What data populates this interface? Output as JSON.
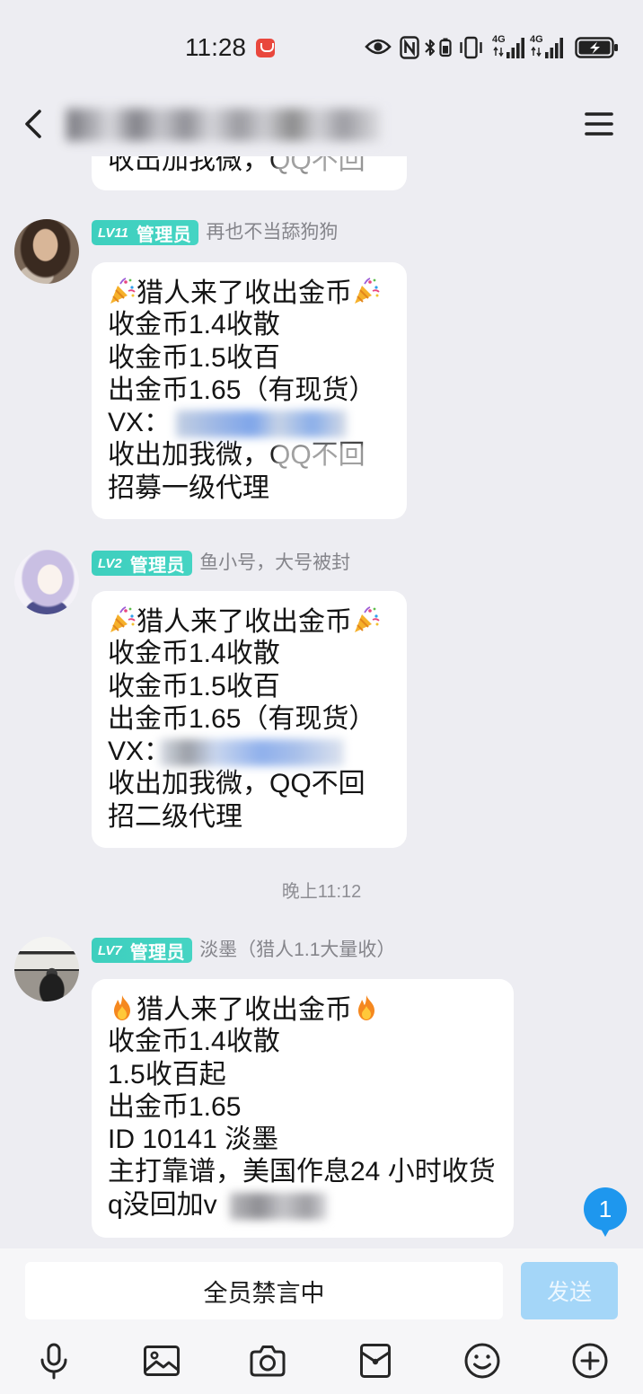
{
  "status_bar": {
    "time": "11:28",
    "network_1": "4G",
    "network_2": "4G",
    "icons": [
      "app-notification-icon",
      "eye-icon",
      "nfc-icon",
      "bluetooth-icon",
      "headset-battery-icon",
      "vibrate-icon",
      "signal-icon",
      "signal-icon",
      "battery-charging-icon"
    ]
  },
  "header": {
    "back_icon": "chevron-left-icon",
    "menu_icon": "menu-icon"
  },
  "partial_message": {
    "text": "收出加我微，QQ不回"
  },
  "messages": [
    {
      "level": "LV11",
      "role": "管理员",
      "sender": "再也不当舔狗狗",
      "lines": [
        {
          "icon": "party-popper-icon",
          "text": "猎人来了收出金币"
        },
        {
          "text": "收金币1.4收散"
        },
        {
          "text": "收金币1.5收百"
        },
        {
          "text": "出金币1.65（有现货）"
        },
        {
          "text": "VX："
        },
        {
          "text": "收出加我微，QQ不回"
        },
        {
          "text": "招募一级代理"
        }
      ]
    },
    {
      "level": "LV2",
      "role": "管理员",
      "sender": "鱼小号，大号被封",
      "lines": [
        {
          "icon": "party-popper-icon",
          "text": "猎人来了收出金币"
        },
        {
          "text": "收金币1.4收散"
        },
        {
          "text": "收金币1.5收百"
        },
        {
          "text": "出金币1.65（有现货）"
        },
        {
          "text": "VX："
        },
        {
          "text": "收出加我微，QQ不回"
        },
        {
          "text": "招二级代理"
        }
      ]
    },
    {
      "level": "LV7",
      "role": "管理员",
      "sender": "淡墨（猎人1.1大量收）",
      "lines": [
        {
          "icon": "fire-icon",
          "text": "猎人来了收出金币"
        },
        {
          "text": "收金币1.4收散"
        },
        {
          "text": "1.5收百起"
        },
        {
          "text": "出金币1.65"
        },
        {
          "text": "ID 10141 淡墨"
        },
        {
          "text": "主打靠谱，美国作息24 小时收货"
        },
        {
          "text": "q没回加v"
        }
      ]
    }
  ],
  "timestamp": "晚上11:12",
  "unread_count": "1",
  "input_bar": {
    "muted_notice": "全员禁言中",
    "send_label": "发送"
  },
  "toolbar": {
    "icons": [
      "microphone-icon",
      "image-icon",
      "camera-icon",
      "red-packet-icon",
      "emoji-icon",
      "plus-icon"
    ]
  },
  "colors": {
    "chat_background": "#EDEDF2",
    "bubble": "#FFFFFF",
    "admin_badge": "#45D4C3",
    "unread_badge": "#1E97EE",
    "send_button": "#A4D6F8"
  }
}
